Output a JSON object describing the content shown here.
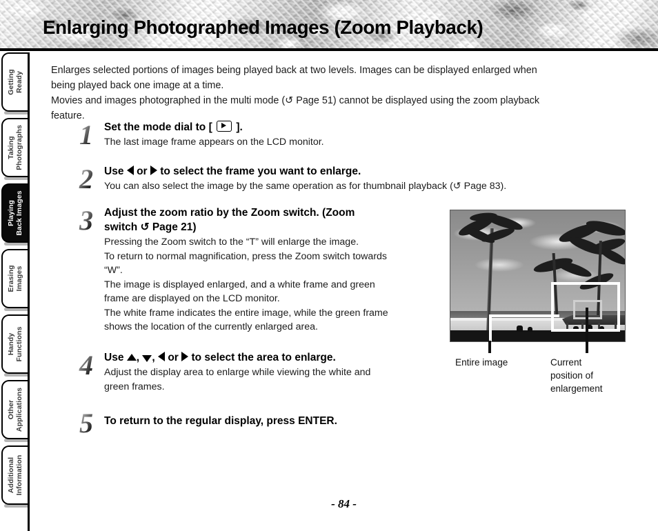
{
  "page": {
    "title": "Enlarging Photographed Images (Zoom Playback)",
    "number": "- 84 -"
  },
  "sidebar": {
    "items": [
      {
        "label": "Getting\nReady",
        "line1": "Getting",
        "line2": "Ready",
        "active": false
      },
      {
        "label": "Taking\nPhotographs",
        "line1": "Taking",
        "line2": "Photographs",
        "active": false
      },
      {
        "label": "Playing\nBack Images",
        "line1": "Playing",
        "line2": "Back Images",
        "active": true
      },
      {
        "label": "Erasing\nImages",
        "line1": "Erasing",
        "line2": "Images",
        "active": false
      },
      {
        "label": "Handy\nFunctions",
        "line1": "Handy",
        "line2": "Functions",
        "active": false
      },
      {
        "label": "Other\nApplications",
        "line1": "Other",
        "line2": "Applications",
        "active": false
      },
      {
        "label": "Additional\nInformation",
        "line1": "Additional",
        "line2": "Information",
        "active": false
      }
    ]
  },
  "intro": {
    "line1": "Enlarges selected portions of images being played back at two levels. Images can be displayed enlarged when",
    "line2": "being played back one image at a time.",
    "line3a": "Movies and images photographed in the multi mode (",
    "line3_ref": "↺",
    "line3b": " Page 51) cannot be displayed using the zoom playback",
    "line4": "feature."
  },
  "steps": [
    {
      "number": "1",
      "heading_a": "Set the mode dial to [",
      "heading_icon": "playback-icon",
      "heading_b": "].",
      "body": [
        "The last image frame appears on the LCD monitor."
      ]
    },
    {
      "number": "2",
      "heading_a": "Use",
      "heading_mid": "or",
      "heading_b": "to select the frame you want to enlarge.",
      "body": [
        "You can also select the image by the same operation as for thumbnail playback (↺ Page 83)."
      ]
    },
    {
      "number": "3",
      "heading_a": "Adjust the zoom ratio by the Zoom switch. (Zoom",
      "heading_b": "switch ↺ Page 21)",
      "body": [
        "Pressing the Zoom switch to the “T” will enlarge the image.",
        "To return to normal magnification, press the Zoom switch towards",
        "“W”.",
        "The image is displayed enlarged, and a white frame and green",
        "frame are displayed on the LCD monitor.",
        "The white frame indicates the entire image, while the green frame",
        "shows the location of the currently enlarged area."
      ]
    },
    {
      "number": "4",
      "heading_a": "Use",
      "heading_mid1": ",",
      "heading_mid2": ",",
      "heading_mid3": "or",
      "heading_b": "to select the area to enlarge.",
      "body": [
        "Adjust the display area to enlarge while viewing the white and",
        "green frames."
      ]
    },
    {
      "number": "5",
      "heading_a": "To return to the regular display, press ENTER.",
      "body": []
    }
  ],
  "figure": {
    "caption_entire": "Entire image",
    "caption_current_l1": "Current",
    "caption_current_l2": "position of",
    "caption_current_l3": "enlargement",
    "alt": "Beach scene with palm trees, white frame showing entire image and green frame showing enlarged area"
  },
  "colors": {
    "white_frame": "#ffffff",
    "green_frame": "#cfcfcf",
    "active_tab_bg": "#0a0a0a",
    "rule": "#000000"
  }
}
